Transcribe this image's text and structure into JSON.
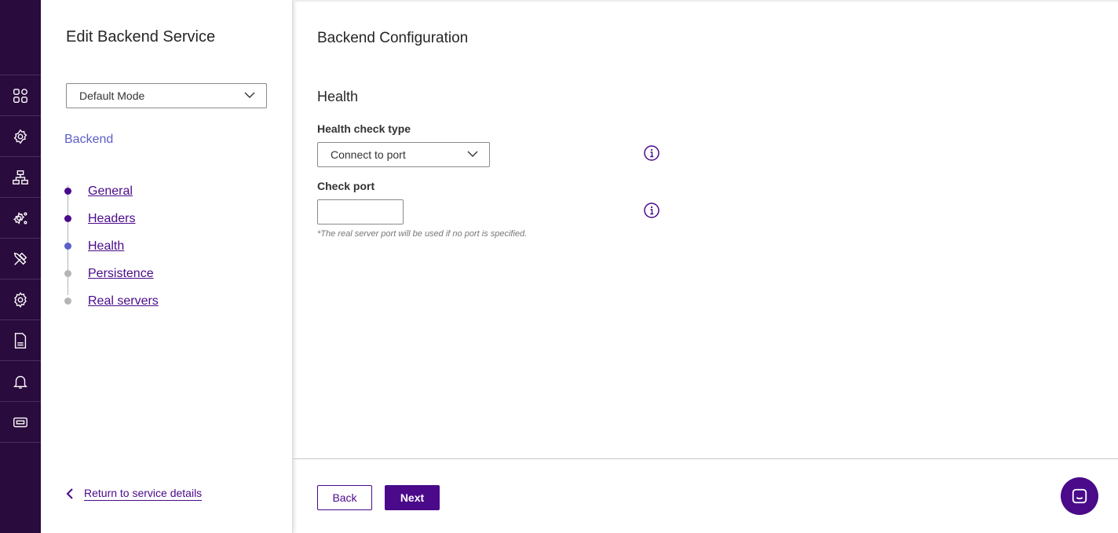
{
  "rail": {
    "icons": [
      "dashboard-icon",
      "services-icon",
      "network-icon",
      "system-settings-icon",
      "tools-icon",
      "settings-icon",
      "log-file-icon",
      "notifications-icon",
      "license-icon"
    ]
  },
  "panel": {
    "title": "Edit Backend Service",
    "mode_value": "Default Mode",
    "section_label": "Backend",
    "steps": [
      {
        "label": "General",
        "status": "complete",
        "color": "#4a0a8a"
      },
      {
        "label": "Headers",
        "status": "complete",
        "color": "#4a0a8a"
      },
      {
        "label": "Health",
        "status": "current",
        "color": "#5b5fc7"
      },
      {
        "label": "Persistence",
        "status": "pending",
        "color": "#b5b5b5"
      },
      {
        "label": "Real servers",
        "status": "pending",
        "color": "#b5b5b5"
      }
    ],
    "return_label": "Return to service details"
  },
  "main": {
    "title": "Backend Configuration",
    "section_title": "Health",
    "health_check_type_label": "Health check type",
    "health_check_type_value": "Connect to port",
    "check_port_label": "Check port",
    "check_port_value": "",
    "check_port_hint": "*The real server port will be used if no port is specified.",
    "back_label": "Back",
    "next_label": "Next"
  },
  "colors": {
    "rail_bg": "#2a0b3d",
    "primary": "#4a0a8a",
    "accent": "#5b5fc7"
  }
}
